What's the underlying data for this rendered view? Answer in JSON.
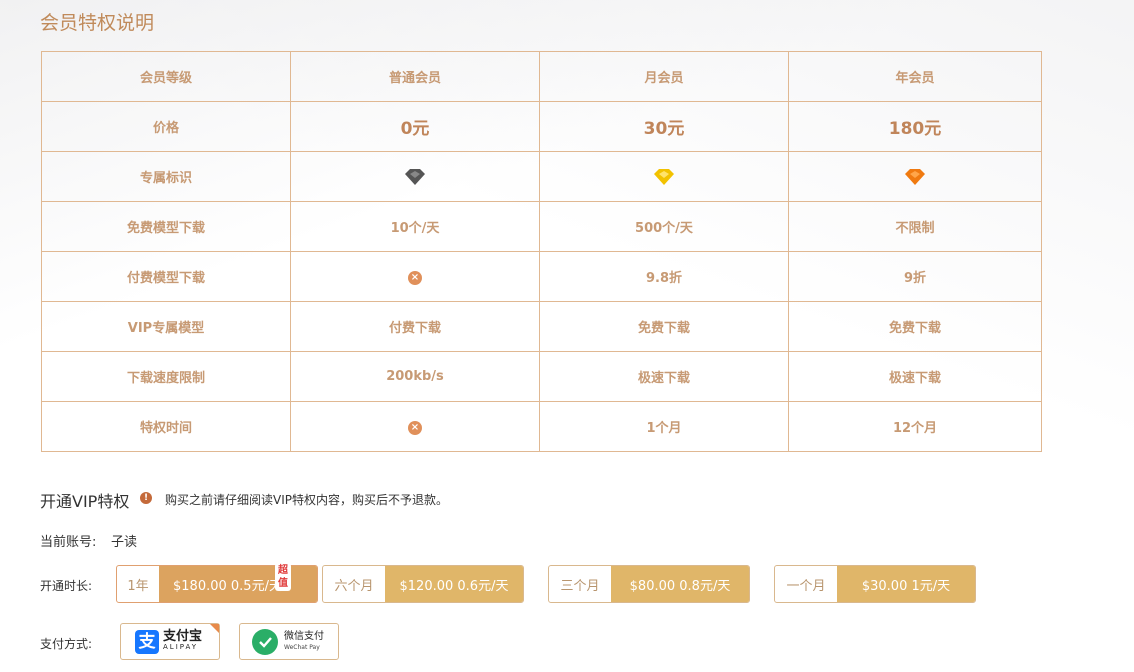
{
  "section_title": "会员特权说明",
  "table": {
    "rows": [
      {
        "label": "会员等级",
        "cells": [
          "普通会员",
          "月会员",
          "年会员"
        ],
        "type": "text"
      },
      {
        "label": "价格",
        "cells": [
          "0元",
          "30元",
          "180元"
        ],
        "type": "price"
      },
      {
        "label": "专属标识",
        "cells": [
          "gray-diamond-icon",
          "yellow-diamond-icon",
          "orange-diamond-icon"
        ],
        "type": "icon"
      },
      {
        "label": "免费模型下载",
        "cells": [
          "10个/天",
          "500个/天",
          "不限制"
        ],
        "type": "text"
      },
      {
        "label": "付费模型下载",
        "cells": [
          "x-circle-icon",
          "9.8折",
          "9折"
        ],
        "type": "mixed"
      },
      {
        "label": "VIP专属模型",
        "cells": [
          "付费下载",
          "免费下载",
          "免费下载"
        ],
        "type": "text"
      },
      {
        "label": "下载速度限制",
        "cells": [
          "200kb/s",
          "极速下载",
          "极速下载"
        ],
        "type": "text"
      },
      {
        "label": "特权时间",
        "cells": [
          "x-circle-icon",
          "1个月",
          "12个月"
        ],
        "type": "mixed"
      }
    ]
  },
  "open_vip": {
    "title": "开通VIP特权",
    "warning": "购买之前请仔细阅读VIP特权内容，购买后不予退款。"
  },
  "account": {
    "label": "当前账号:",
    "value": "子读"
  },
  "duration": {
    "label": "开通时长:",
    "tag": "超值",
    "plans": [
      {
        "name": "1年",
        "price": "$180.00 0.5元/天",
        "selected": true
      },
      {
        "name": "六个月",
        "price": "$120.00 0.6元/天",
        "selected": false
      },
      {
        "name": "三个月",
        "price": "$80.00 0.8元/天",
        "selected": false
      },
      {
        "name": "一个月",
        "price": "$30.00 1元/天",
        "selected": false
      }
    ]
  },
  "payment": {
    "label": "支付方式:",
    "alipay": {
      "cn": "支付宝",
      "en": "ALIPAY",
      "logo_char": "支"
    },
    "wechat": {
      "cn": "微信支付",
      "en": "WeChat Pay"
    }
  },
  "colors": {
    "accent": "#c79a74",
    "border": "#e0b892",
    "price_bg": "#e0b669",
    "alipay": "#1677ff",
    "wechat": "#2aae67"
  }
}
